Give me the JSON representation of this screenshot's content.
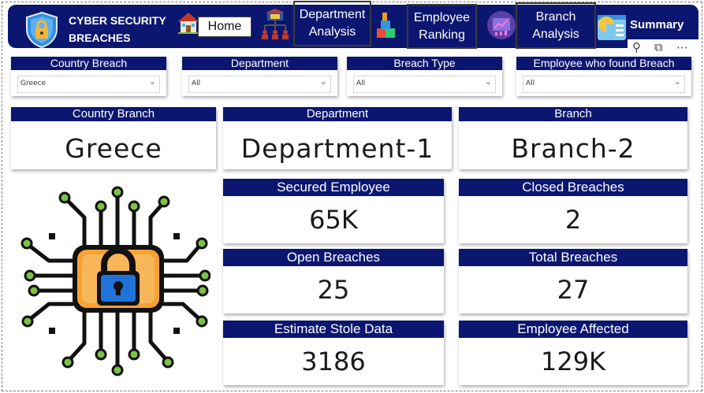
{
  "header": {
    "brand_line1": "CYBER SECURITY",
    "brand_line2": "BREACHES",
    "nav": {
      "home": "Home",
      "department_analysis_1": "Department",
      "department_analysis_2": "Analysis",
      "employee_ranking_1": "Employee",
      "employee_ranking_2": "Ranking",
      "branch_analysis_1": "Branch",
      "branch_analysis_2": "Analysis",
      "summary": "Summary"
    }
  },
  "slicers": [
    {
      "title": "Country Breach",
      "value": "Greece"
    },
    {
      "title": "Department",
      "value": "All"
    },
    {
      "title": "Breach Type",
      "value": "All"
    },
    {
      "title": "Employee who found Breach",
      "value": "All"
    }
  ],
  "cards": {
    "country_branch": {
      "title": "Country Branch",
      "value": "Greece"
    },
    "department": {
      "title": "Department",
      "value": "Department-1"
    },
    "branch": {
      "title": "Branch",
      "value": "Branch-2"
    },
    "secured_employee": {
      "title": "Secured Employee",
      "value": "65K"
    },
    "closed_breaches": {
      "title": "Closed Breaches",
      "value": "2"
    },
    "open_breaches": {
      "title": "Open Breaches",
      "value": "25"
    },
    "total_breaches": {
      "title": "Total Breaches",
      "value": "27"
    },
    "estimate_stole_data": {
      "title": "Estimate Stole Data",
      "value": "3186"
    },
    "employee_affected": {
      "title": "Employee Affected",
      "value": "129K"
    }
  },
  "colors": {
    "navy": "#0b1670",
    "chip_orange": "#f6a233",
    "lock_blue": "#1f73d9",
    "node_green": "#7dc242"
  },
  "icons": [
    "shield-lock-icon",
    "house-icon",
    "org-chart-icon",
    "blocks-icon",
    "analytics-icon",
    "dashboard-icon",
    "filter-icon",
    "focus-mode-icon",
    "more-options-icon",
    "cyber-chip-lock-icon"
  ]
}
